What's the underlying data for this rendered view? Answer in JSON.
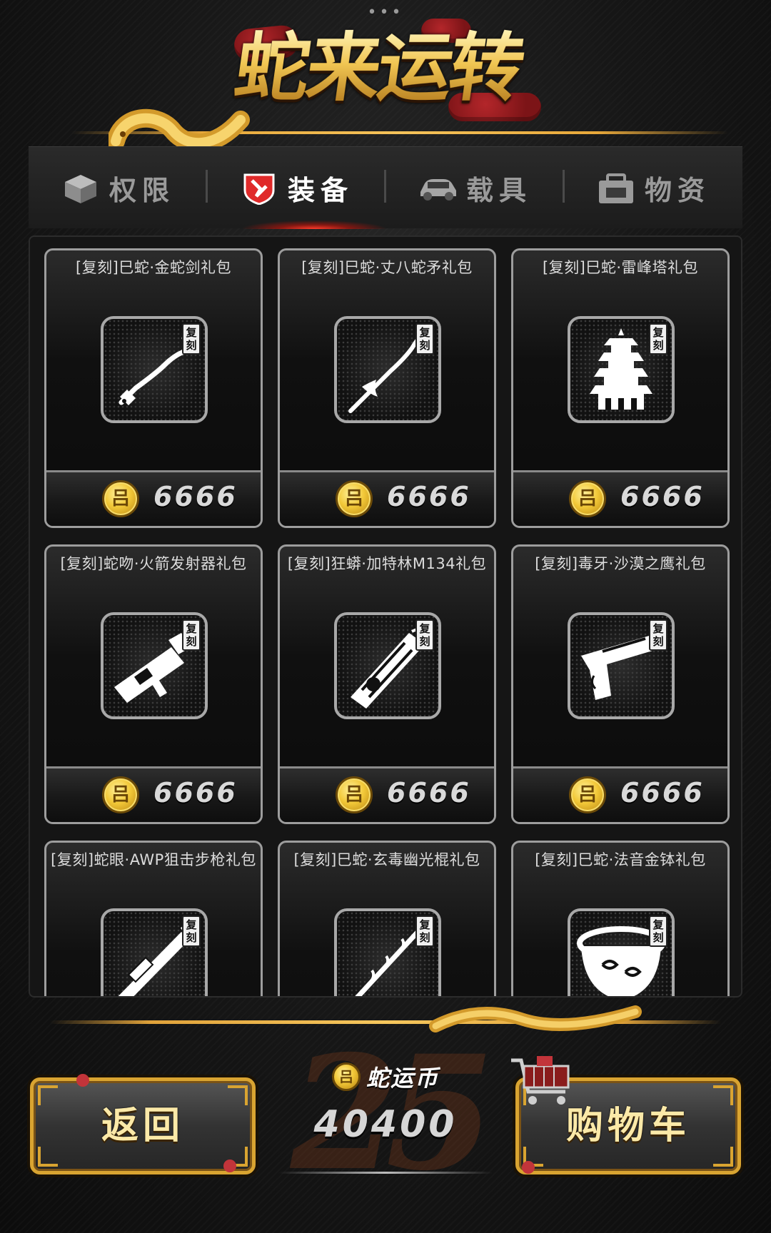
{
  "header": {
    "title": "蛇来运转"
  },
  "tabs": [
    {
      "label": "权限",
      "icon": "box-icon",
      "active": false
    },
    {
      "label": "装备",
      "icon": "shield-emblem-icon",
      "active": true
    },
    {
      "label": "载具",
      "icon": "car-icon",
      "active": false
    },
    {
      "label": "物资",
      "icon": "supply-crate-icon",
      "active": false
    }
  ],
  "items": [
    {
      "title": "[复刻]巳蛇·金蛇剑礼包",
      "badge": "复刻",
      "icon": "snake-sword-icon",
      "price": "6666"
    },
    {
      "title": "[复刻]巳蛇·丈八蛇矛礼包",
      "badge": "复刻",
      "icon": "serpent-spear-icon",
      "price": "6666"
    },
    {
      "title": "[复刻]巳蛇·雷峰塔礼包",
      "badge": "复刻",
      "icon": "pagoda-icon",
      "price": "6666"
    },
    {
      "title": "[复刻]蛇吻·火箭发射器礼包",
      "badge": "复刻",
      "icon": "rocket-launcher-icon",
      "price": "6666"
    },
    {
      "title": "[复刻]狂蟒·加特林M134礼包",
      "badge": "复刻",
      "icon": "gatling-gun-icon",
      "price": "6666"
    },
    {
      "title": "[复刻]毒牙·沙漠之鹰礼包",
      "badge": "复刻",
      "icon": "desert-eagle-pistol-icon",
      "price": "6666"
    },
    {
      "title": "[复刻]蛇眼·AWP狙击步枪礼包",
      "badge": "复刻",
      "icon": "sniper-rifle-icon",
      "price": ""
    },
    {
      "title": "[复刻]巳蛇·玄毒幽光棍礼包",
      "badge": "复刻",
      "icon": "staff-icon",
      "price": ""
    },
    {
      "title": "[复刻]巳蛇·法音金钵礼包",
      "badge": "复刻",
      "icon": "golden-bowl-icon",
      "price": ""
    }
  ],
  "coin_glyph": "吕",
  "currency": {
    "label": "蛇运币",
    "amount": "40400"
  },
  "buttons": {
    "back": "返回",
    "cart": "购物车"
  },
  "colors": {
    "gold": "#f0c552",
    "active_tab_glow": "#ff3b2a",
    "card_border": "#9d9d9d"
  }
}
